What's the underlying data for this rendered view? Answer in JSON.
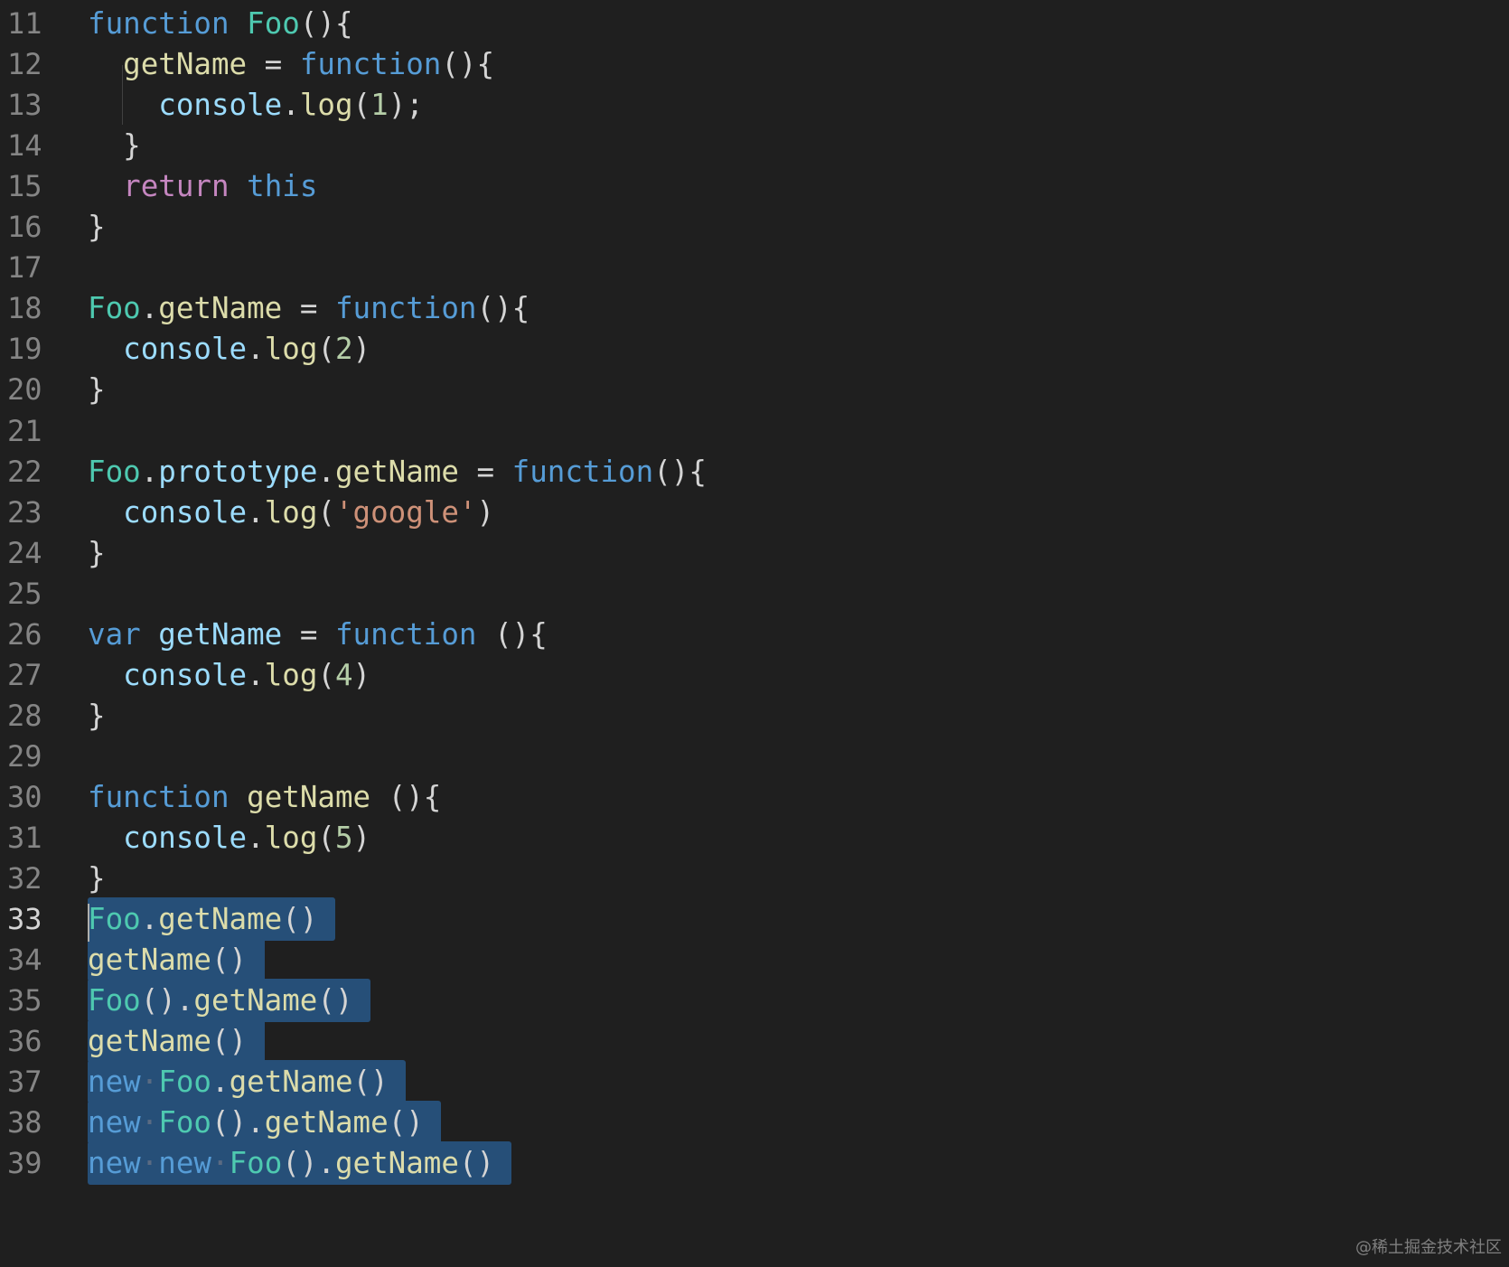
{
  "editor": {
    "language": "javascript",
    "theme": "dark",
    "first_line_number": 11,
    "active_line": 33,
    "colors": {
      "background": "#1f1f1f",
      "selection": "#264f78",
      "line_number": "#858585",
      "keyword": "#569cd6",
      "control": "#c586c0",
      "type": "#4ec9b0",
      "function": "#dcdcaa",
      "variable": "#9cdcfe",
      "number": "#b5cea8",
      "string": "#ce9178"
    },
    "lines": [
      {
        "n": "11",
        "tokens": [
          [
            "kw",
            "function"
          ],
          [
            "punc",
            " "
          ],
          [
            "type",
            "Foo"
          ],
          [
            "punc",
            "(){"
          ]
        ]
      },
      {
        "n": "12",
        "tokens": [
          [
            "punc",
            "  "
          ],
          [
            "fn",
            "getName"
          ],
          [
            "punc",
            " = "
          ],
          [
            "kw",
            "function"
          ],
          [
            "punc",
            "(){"
          ]
        ]
      },
      {
        "n": "13",
        "tokens": [
          [
            "punc",
            "    "
          ],
          [
            "var",
            "console"
          ],
          [
            "punc",
            "."
          ],
          [
            "fn",
            "log"
          ],
          [
            "punc",
            "("
          ],
          [
            "num",
            "1"
          ],
          [
            "punc",
            ");"
          ]
        ]
      },
      {
        "n": "14",
        "tokens": [
          [
            "punc",
            "  }"
          ]
        ]
      },
      {
        "n": "15",
        "tokens": [
          [
            "punc",
            "  "
          ],
          [
            "ctrl",
            "return"
          ],
          [
            "punc",
            " "
          ],
          [
            "kw",
            "this"
          ]
        ]
      },
      {
        "n": "16",
        "tokens": [
          [
            "punc",
            "}"
          ]
        ]
      },
      {
        "n": "17",
        "tokens": []
      },
      {
        "n": "18",
        "tokens": [
          [
            "type",
            "Foo"
          ],
          [
            "punc",
            "."
          ],
          [
            "fn",
            "getName"
          ],
          [
            "punc",
            " = "
          ],
          [
            "kw",
            "function"
          ],
          [
            "punc",
            "(){"
          ]
        ]
      },
      {
        "n": "19",
        "tokens": [
          [
            "punc",
            "  "
          ],
          [
            "var",
            "console"
          ],
          [
            "punc",
            "."
          ],
          [
            "fn",
            "log"
          ],
          [
            "punc",
            "("
          ],
          [
            "num",
            "2"
          ],
          [
            "punc",
            ")"
          ]
        ]
      },
      {
        "n": "20",
        "tokens": [
          [
            "punc",
            "}"
          ]
        ]
      },
      {
        "n": "21",
        "tokens": []
      },
      {
        "n": "22",
        "tokens": [
          [
            "type",
            "Foo"
          ],
          [
            "punc",
            "."
          ],
          [
            "var",
            "prototype"
          ],
          [
            "punc",
            "."
          ],
          [
            "fn",
            "getName"
          ],
          [
            "punc",
            " = "
          ],
          [
            "kw",
            "function"
          ],
          [
            "punc",
            "(){"
          ]
        ]
      },
      {
        "n": "23",
        "tokens": [
          [
            "punc",
            "  "
          ],
          [
            "var",
            "console"
          ],
          [
            "punc",
            "."
          ],
          [
            "fn",
            "log"
          ],
          [
            "punc",
            "("
          ],
          [
            "str",
            "'google'"
          ],
          [
            "punc",
            ")"
          ]
        ]
      },
      {
        "n": "24",
        "tokens": [
          [
            "punc",
            "}"
          ]
        ]
      },
      {
        "n": "25",
        "tokens": []
      },
      {
        "n": "26",
        "tokens": [
          [
            "kw",
            "var"
          ],
          [
            "punc",
            " "
          ],
          [
            "var",
            "getName"
          ],
          [
            "punc",
            " = "
          ],
          [
            "kw",
            "function"
          ],
          [
            "punc",
            " (){"
          ]
        ]
      },
      {
        "n": "27",
        "tokens": [
          [
            "punc",
            "  "
          ],
          [
            "var",
            "console"
          ],
          [
            "punc",
            "."
          ],
          [
            "fn",
            "log"
          ],
          [
            "punc",
            "("
          ],
          [
            "num",
            "4"
          ],
          [
            "punc",
            ")"
          ]
        ]
      },
      {
        "n": "28",
        "tokens": [
          [
            "punc",
            "}"
          ]
        ]
      },
      {
        "n": "29",
        "tokens": []
      },
      {
        "n": "30",
        "tokens": [
          [
            "kw",
            "function"
          ],
          [
            "punc",
            " "
          ],
          [
            "fn",
            "getName"
          ],
          [
            "punc",
            " (){"
          ]
        ]
      },
      {
        "n": "31",
        "tokens": [
          [
            "punc",
            "  "
          ],
          [
            "var",
            "console"
          ],
          [
            "punc",
            "."
          ],
          [
            "fn",
            "log"
          ],
          [
            "punc",
            "("
          ],
          [
            "num",
            "5"
          ],
          [
            "punc",
            ")"
          ]
        ]
      },
      {
        "n": "32",
        "tokens": [
          [
            "punc",
            "}"
          ]
        ]
      },
      {
        "n": "33",
        "tokens": [
          [
            "type",
            "Foo"
          ],
          [
            "punc",
            "."
          ],
          [
            "fn",
            "getName"
          ],
          [
            "punc",
            "()"
          ]
        ],
        "selected": true
      },
      {
        "n": "34",
        "tokens": [
          [
            "fn",
            "getName"
          ],
          [
            "punc",
            "()"
          ]
        ],
        "selected": true
      },
      {
        "n": "35",
        "tokens": [
          [
            "type",
            "Foo"
          ],
          [
            "punc",
            "()."
          ],
          [
            "fn",
            "getName"
          ],
          [
            "punc",
            "()"
          ]
        ],
        "selected": true
      },
      {
        "n": "36",
        "tokens": [
          [
            "fn",
            "getName"
          ],
          [
            "punc",
            "()"
          ]
        ],
        "selected": true
      },
      {
        "n": "37",
        "tokens": [
          [
            "kw",
            "new"
          ],
          [
            "dot",
            "·"
          ],
          [
            "type",
            "Foo"
          ],
          [
            "punc",
            "."
          ],
          [
            "fn",
            "getName"
          ],
          [
            "punc",
            "()"
          ]
        ],
        "selected": true
      },
      {
        "n": "38",
        "tokens": [
          [
            "kw",
            "new"
          ],
          [
            "dot",
            "·"
          ],
          [
            "type",
            "Foo"
          ],
          [
            "punc",
            "()."
          ],
          [
            "fn",
            "getName"
          ],
          [
            "punc",
            "()"
          ]
        ],
        "selected": true
      },
      {
        "n": "39",
        "tokens": [
          [
            "kw",
            "new"
          ],
          [
            "dot",
            "·"
          ],
          [
            "kw",
            "new"
          ],
          [
            "dot",
            "·"
          ],
          [
            "type",
            "Foo"
          ],
          [
            "punc",
            "()."
          ],
          [
            "fn",
            "getName"
          ],
          [
            "punc",
            "()"
          ]
        ],
        "selected": true
      }
    ]
  },
  "watermark": "@稀土掘金技术社区"
}
